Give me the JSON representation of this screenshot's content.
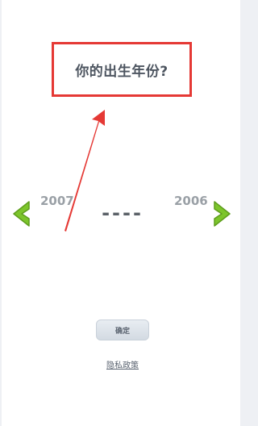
{
  "question": {
    "title": "你的出生年份?"
  },
  "year_picker": {
    "previous_year": "2007",
    "next_year": "2006",
    "current_value": "----"
  },
  "actions": {
    "confirm_label": "确定",
    "privacy_label": "隐私政策"
  },
  "colors": {
    "highlight_border": "#e53935",
    "chevron_green": "#7cc52b",
    "background": "#ffffff"
  },
  "icons": {
    "left": "chevron-left-icon",
    "right": "chevron-right-icon"
  }
}
